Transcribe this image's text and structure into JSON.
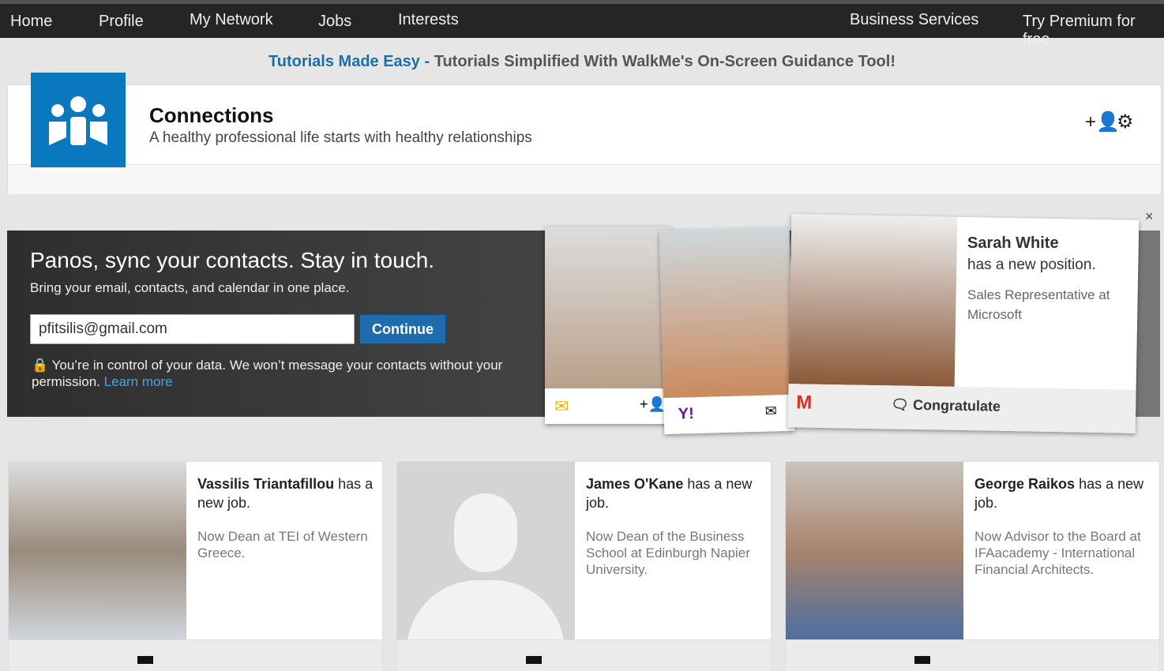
{
  "nav": {
    "left": [
      "Home",
      "Profile",
      "My Network",
      "Jobs",
      "Interests"
    ],
    "right": [
      "Business Services",
      "Try Premium for free"
    ]
  },
  "banner": {
    "highlight": "Tutorials Made Easy -",
    "text": " Tutorials Simplified With WalkMe's On-Screen Guidance Tool!"
  },
  "header": {
    "title": "Connections",
    "subtitle": "A healthy professional life starts with healthy relationships",
    "accent": "#0a78be"
  },
  "sync": {
    "title": "Panos, sync your contacts. Stay in touch.",
    "subtitle": "Bring your email, contacts, and calendar in one place.",
    "email_value": "pfitsilis@gmail.com",
    "continue_label": "Continue",
    "privacy": "You’re in control of your data. We won’t message your contacts without your permission.",
    "learn_more": "Learn more",
    "close": "×"
  },
  "promo": {
    "name": "Sarah White",
    "line": "has a new position.",
    "position": "Sales Representative at Microsoft",
    "congratulate": "Congratulate"
  },
  "feed": [
    {
      "name": "Vassilis Triantafillou",
      "action": "has a new job.",
      "desc": "Now Dean at TEI of Western Greece."
    },
    {
      "name": "James O'Kane",
      "action": "has a new job.",
      "desc": "Now Dean of the Business School at Edinburgh Napier University."
    },
    {
      "name": "George Raikos",
      "action": "has a new job.",
      "desc": "Now Advisor to the Board at IFAacademy - International Financial Architects."
    }
  ]
}
